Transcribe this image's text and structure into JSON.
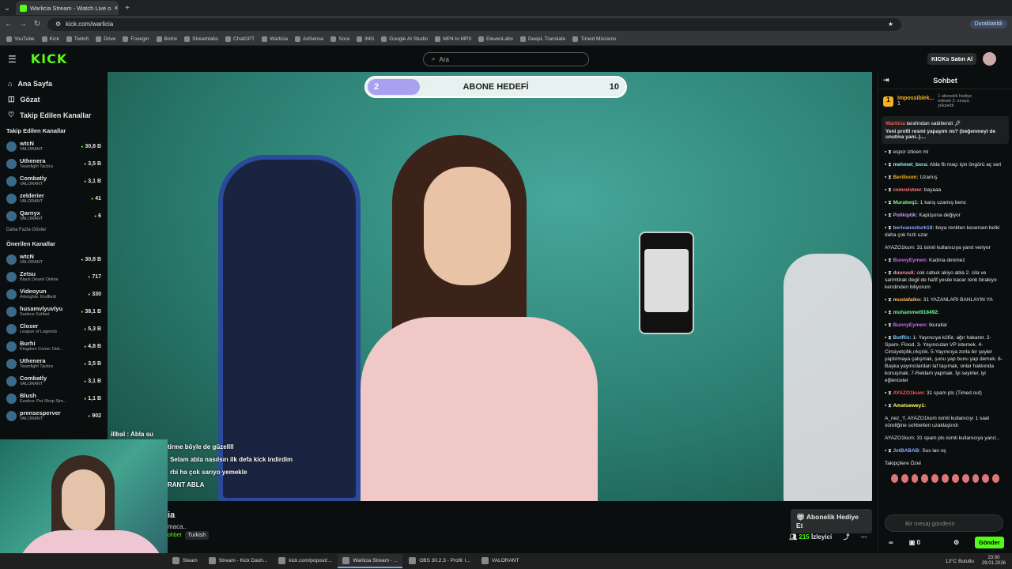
{
  "browser": {
    "tab_title": "Warlicia Stream - Watch Live o",
    "url": "kick.com/warlicia",
    "profile": "Duraklatıldı",
    "bookmarks": [
      "YouTube",
      "Kick",
      "Twitch",
      "Drive",
      "Foxegin",
      "Botrix",
      "Streamlabs",
      "ChatGPT",
      "Warlicia",
      "AdSense",
      "Sora",
      "IMG",
      "Google AI Studio",
      "MP4 to MP3",
      "ElevenLabs",
      "DeepL Translate",
      "Timed Missions"
    ]
  },
  "header": {
    "logo": "KICK",
    "search_placeholder": "Ara",
    "buy_kicks": "KICKs Satın Al"
  },
  "sidebar": {
    "nav": [
      "Ana Sayfa",
      "Gözat",
      "Takip Edilen Kanallar"
    ],
    "followed_title": "Takip Edilen Kanallar",
    "followed": [
      {
        "n": "wtcN",
        "g": "VALORANT",
        "v": "30,8 B"
      },
      {
        "n": "Uthenera",
        "g": "Teamfight Tactics",
        "v": "3,5 B"
      },
      {
        "n": "Combatly",
        "g": "VALORANT",
        "v": "3,1 B"
      },
      {
        "n": "zelderier",
        "g": "VALORANT",
        "v": "41"
      },
      {
        "n": "Qarnyx",
        "g": "VALORANT",
        "v": "6"
      }
    ],
    "more": "Daha Fazla Göster",
    "recommended_title": "Önerilen Kanallar",
    "recommended": [
      {
        "n": "wtcN",
        "g": "VALORANT",
        "v": "30,8 B"
      },
      {
        "n": "Zetsu",
        "g": "Black Desert Online",
        "v": "717"
      },
      {
        "n": "Videoyun",
        "g": "Arknights: Endfield",
        "v": "330"
      },
      {
        "n": "husamvlyuvlyu",
        "g": "Sadece Sohbet",
        "v": "38,1 B"
      },
      {
        "n": "Closer",
        "g": "League of Legends",
        "v": "5,3 B"
      },
      {
        "n": "Burhi",
        "g": "Kingdom Come: Deli...",
        "v": "4,8 B"
      },
      {
        "n": "Uthenera",
        "g": "Teamfight Tactics",
        "v": "3,5 B"
      },
      {
        "n": "Combatly",
        "g": "VALORANT",
        "v": "3,1 B"
      },
      {
        "n": "Blush",
        "g": "Exotica: Pet Shop Sim...",
        "v": "1,1 B"
      },
      {
        "n": "prensesperver",
        "g": "VALORANT",
        "v": "902"
      }
    ]
  },
  "goal": {
    "current": "2",
    "label": "ABONE HEDEFİ",
    "target": "10",
    "progress": 0.2
  },
  "overlay_chat": [
    "illbal : Abla su",
    "tirme böyle de güzellll",
    "Selam abla nasılsın ilk defa kick indirdim",
    "rbi ha çok sarıyo yemekle",
    "RANT ABLA"
  ],
  "stream": {
    "title": "ia",
    "subtitle": "macа..",
    "category": "ohbet",
    "tag": "Turkish",
    "gift": "Abonelik Hediye Et",
    "viewers": "215",
    "viewers_label": "İzleyici"
  },
  "chat": {
    "title": "Sohbet",
    "top_gifter": "Impossiblek...",
    "top_gifter_count": "1",
    "gifter_desc": "1 abonelik hediye ederek 2. sıraya yükseldi",
    "pinned_by": "Warlicia",
    "pinned_suffix": "tarafından sabitlendi",
    "pinned_text": "Yeni profil resmi yapayım mı? (beğenmeyi de unutma yani..)....",
    "messages": [
      {
        "u": "",
        "c": "#fff",
        "t": "espor izlicen mi"
      },
      {
        "u": "mehmet_bora:",
        "c": "#8ef",
        "t": "Abla fb maçı için öngörü aç seri"
      },
      {
        "u": "Berilloom:",
        "c": "#f3b221",
        "t": "Uzamış"
      },
      {
        "u": "cemrelstew:",
        "c": "#f77",
        "t": "bayaaa"
      },
      {
        "u": "Muratwq1:",
        "c": "#7f7",
        "t": "1 karış uzamış benc"
      },
      {
        "u": "Polikiptik:",
        "c": "#c9f",
        "t": "Kapüşona değiyor"
      },
      {
        "u": "berivanozturk18:",
        "c": "#8af",
        "t": "boya renkten kesersen belki daha çok hızlı uzar"
      },
      {
        "u": "BunnyEymen:",
        "c": "#c6f",
        "t": "Kadına denmez"
      },
      {
        "u": "duuruuli:",
        "c": "#f9a",
        "t": "cok cabuk akiyo abla 2. cila ve sarimtirak degil de hafif yesile kacar renk birakiyo kendinden biliyorum"
      },
      {
        "u": "mustafaiko:",
        "c": "#fb6",
        "t": "31 YAZANLARI BANLAYIN YA"
      },
      {
        "u": "muhammet918492:",
        "c": "#6f9",
        "t": ""
      },
      {
        "u": "BunnyEymen:",
        "c": "#c6f",
        "t": "Ikurallar"
      },
      {
        "u": "BotRix:",
        "c": "#7cf",
        "t": "1- Yayıncıya küfür, ağır hakaret. 2-Spam- Flood. 3- Yayıncıdan VP istemek. 4-Cinsiyetçilik,ırkçılık. 5-Yayıncıya zorla bir şeyler yaptırmaya çalışmak, şunu yap bunu yap demek. 6-Başka yayıncılardan laf taşımak, onlar hakkında konuşmak. 7-Reklam yapmak. İyi seyirler, iyi eğlenceler"
      },
      {
        "u": "AYAZO1kum:",
        "c": "#f55",
        "t": "31 spam pls (Timed out)"
      },
      {
        "u": "Ametsewey1:",
        "c": "#ff6",
        "t": ""
      },
      {
        "u": "JetBABAB:",
        "c": "#8af",
        "t": "Sus lan oç"
      }
    ],
    "reply_note": "AYAZO1kum: 31 isimli kullanıcıya yanıt veriyor",
    "ban_note": "A_nez_Y, AYAZO1kum isimli kullanıcıyı 1 saat süreliğine sohbetten uzaklaştırdı",
    "reply_note2": "AYAZO1kum: 31 spam pls isimli kullanıcıya yanıt...",
    "followers_only": "Takipçilere Özel",
    "input_placeholder": "Bir mesaj gönderin",
    "points": "0",
    "send": "Gönder"
  },
  "taskbar": {
    "items": [
      "Steam",
      "Stream - Kick Dash...",
      "kick.com/popout/...",
      "Warlicia Stream - ...",
      "OBS 30.2.3 - Profil: l...",
      "VALORANT"
    ],
    "weather": "13°C",
    "weather_label": "Bulutlu",
    "time": "23:00",
    "date": "29.01.2026"
  }
}
